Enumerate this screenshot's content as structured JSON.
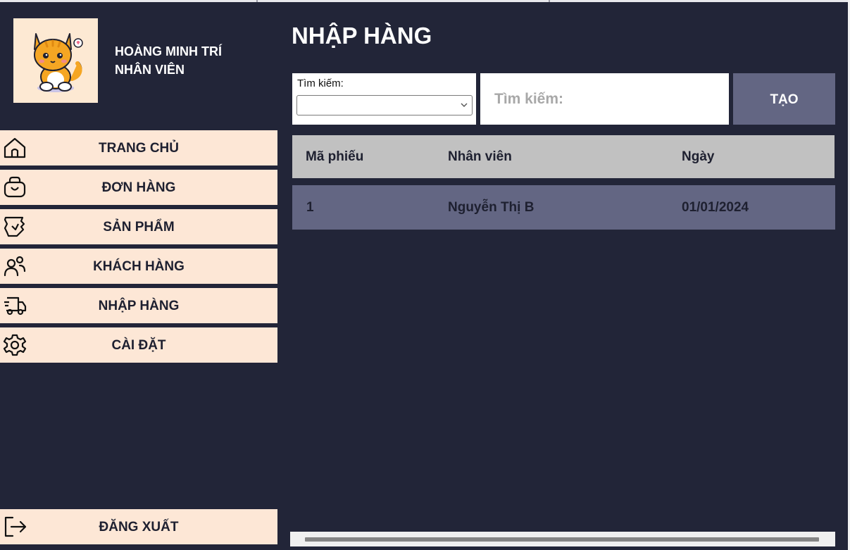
{
  "profile": {
    "name": "HOÀNG MINH TRÍ",
    "role": "NHÂN VIÊN",
    "avatar_icon": "cat-avatar-icon"
  },
  "sidebar": {
    "items": [
      {
        "label": "TRANG CHỦ",
        "icon": "home-icon"
      },
      {
        "label": "ĐƠN HÀNG",
        "icon": "shopping-bag-icon"
      },
      {
        "label": "SẢN PHẨM",
        "icon": "product-tag-icon"
      },
      {
        "label": "KHÁCH HÀNG",
        "icon": "users-icon"
      },
      {
        "label": "NHẬP HÀNG",
        "icon": "delivery-truck-icon"
      },
      {
        "label": "CÀI ĐẶT",
        "icon": "gear-icon"
      }
    ],
    "logout": {
      "label": "ĐĂNG XUẤT",
      "icon": "logout-icon"
    }
  },
  "main": {
    "title": "NHẬP HÀNG",
    "search_filter": {
      "label": "Tìm kiếm:",
      "selected": ""
    },
    "search": {
      "placeholder": "Tìm kiếm:",
      "value": ""
    },
    "create_label": "TẠO",
    "table": {
      "columns": [
        "Mã phiếu",
        "Nhân viên",
        "Ngày"
      ],
      "rows": [
        [
          "1",
          "Nguyễn Thị B",
          "01/01/2024"
        ]
      ]
    }
  },
  "colors": {
    "background": "#222538",
    "nav_item": "#fde7d6",
    "accent": "#636683",
    "table_header": "#c1c1c1"
  }
}
